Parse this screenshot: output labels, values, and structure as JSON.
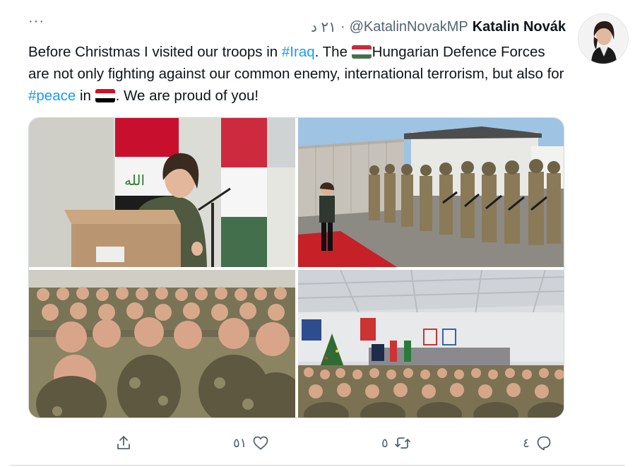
{
  "tweet": {
    "author_name": "Katalin Novák",
    "handle": "@KatalinNovakMP",
    "separator": "·",
    "time": "٢١ د",
    "more_label": "···",
    "text_parts": {
      "p1": "Before Christmas I visited our troops in ",
      "hashtag1": "#Iraq",
      "p2": ". The ",
      "p3": "Hungarian Defence Forces are not only fighting against our common enemy, international terrorism, but also for ",
      "hashtag2": "#peace",
      "p4": " in ",
      "p5": ". We are proud of you!"
    },
    "flags": {
      "hungary": [
        "#ce2939",
        "#ffffff",
        "#477050"
      ],
      "iraq": [
        "#ce1126",
        "#ffffff",
        "#000000"
      ]
    },
    "media": [
      {
        "name": "photo-speech-podium"
      },
      {
        "name": "photo-honor-guard"
      },
      {
        "name": "photo-troops-audience-closeup"
      },
      {
        "name": "photo-hall-audience"
      }
    ]
  },
  "actions": {
    "reply": {
      "icon": "reply-icon",
      "count": "٤"
    },
    "retweet": {
      "icon": "retweet-icon",
      "count": "٥"
    },
    "like": {
      "icon": "heart-icon",
      "count": "٥١"
    },
    "share": {
      "icon": "share-icon"
    }
  },
  "colors": {
    "text": "#0f1419",
    "secondary": "#536471",
    "link": "#1d9bf0",
    "border": "#cfd9de"
  }
}
